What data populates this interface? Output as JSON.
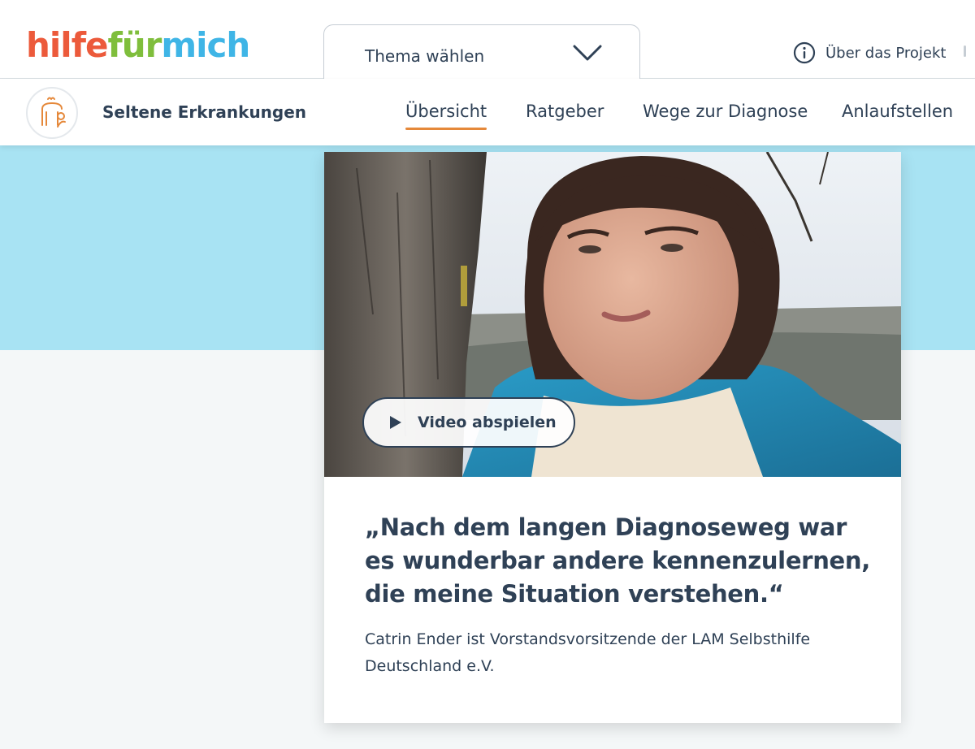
{
  "brand": {
    "logo_part1": "hilfe",
    "logo_part2": "für",
    "logo_part3": "mich",
    "colors": {
      "part1": "#ec5a3b",
      "part2": "#7fbe3c",
      "part3": "#3fb5e6"
    }
  },
  "header": {
    "theme_select": {
      "label": "Thema wählen",
      "icon": "chevron-down-icon"
    },
    "about": {
      "label": "Über das Projekt",
      "icon": "info-icon"
    }
  },
  "subnav": {
    "topic_icon": "people-figure-icon",
    "topic_name": "Seltene Erkrankungen",
    "items": [
      {
        "label": "Übersicht",
        "active": true
      },
      {
        "label": "Ratgeber",
        "active": false
      },
      {
        "label": "Wege zur Diagnose",
        "active": false
      },
      {
        "label": "Anlaufstellen",
        "active": false
      }
    ]
  },
  "card": {
    "video_button_label": "Video abspielen",
    "quote": "„Nach dem langen Diagnoseweg war es wunderbar andere kennenzulernen, die meine Situation verstehen.“",
    "caption": "Catrin Ender ist Vorstandsvorsitzende der LAM Selbsthilfe Deutschland e.V."
  },
  "theme": {
    "accent": "#e5883a",
    "text": "#2f4156",
    "hero_band": "#a8e3f3"
  }
}
